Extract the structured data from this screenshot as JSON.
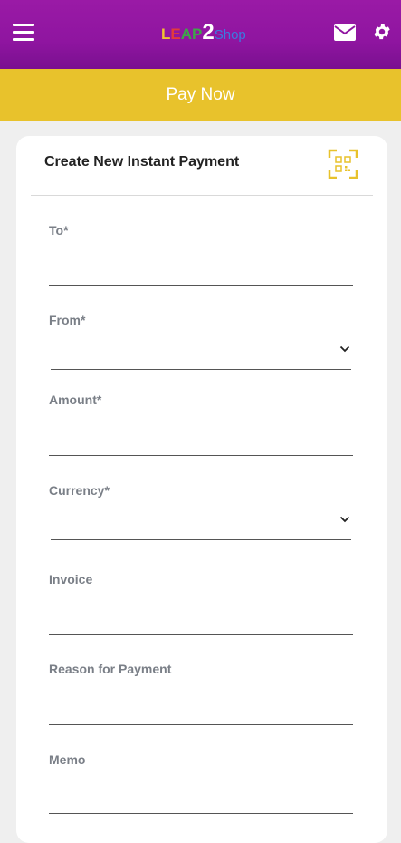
{
  "header": {
    "logo": {
      "p1": "L",
      "p2": "E",
      "p3": "AP",
      "p4": "2",
      "p5": "Shop"
    }
  },
  "paybar": {
    "label": "Pay Now"
  },
  "form": {
    "title": "Create New Instant Payment",
    "fields": [
      {
        "label": "To*",
        "value": ""
      },
      {
        "label": "From*",
        "value": ""
      },
      {
        "label": "Amount*",
        "value": ""
      },
      {
        "label": "Currency*",
        "value": ""
      },
      {
        "label": "Invoice",
        "value": ""
      },
      {
        "label": "Reason for Payment",
        "value": ""
      },
      {
        "label": "Memo",
        "value": ""
      }
    ]
  },
  "colors": {
    "header": "#9a1aa6",
    "accent": "#e8c22c",
    "background": "#efefef"
  },
  "icons": [
    "menu-icon",
    "mail-icon",
    "gear-icon",
    "qr-scan-icon",
    "chevron-down-icon"
  ]
}
